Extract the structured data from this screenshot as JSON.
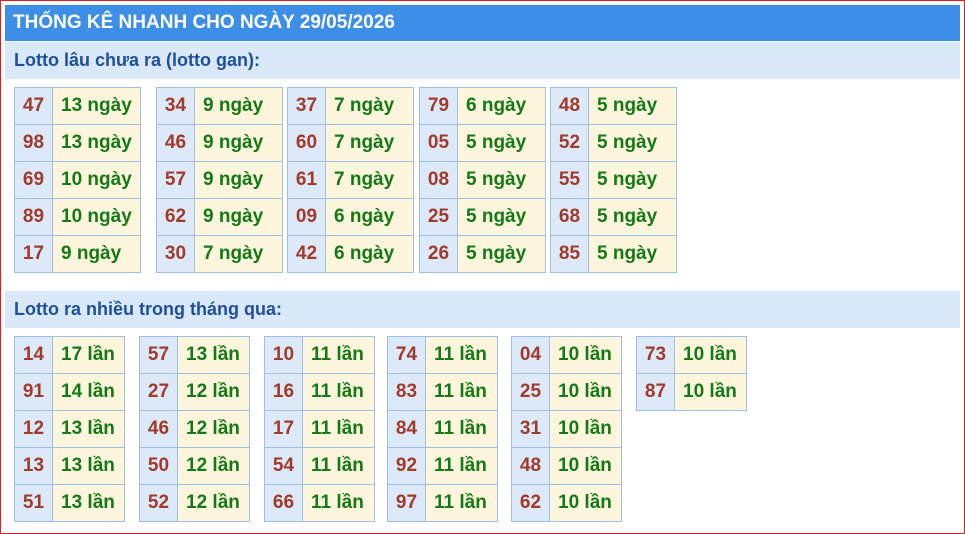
{
  "title": "THỐNG KÊ NHANH CHO NGÀY 29/05/2026",
  "sections": [
    {
      "header": "Lotto lâu chưa ra (lotto gan):",
      "groups": [
        [
          {
            "n": "47",
            "c": "13 ngày"
          },
          {
            "n": "98",
            "c": "13 ngày"
          },
          {
            "n": "69",
            "c": "10 ngày"
          },
          {
            "n": "89",
            "c": "10 ngày"
          },
          {
            "n": "17",
            "c": "9 ngày"
          }
        ],
        [
          {
            "n": "34",
            "c": "9 ngày"
          },
          {
            "n": "46",
            "c": "9 ngày"
          },
          {
            "n": "57",
            "c": "9 ngày"
          },
          {
            "n": "62",
            "c": "9 ngày"
          },
          {
            "n": "30",
            "c": "7 ngày"
          }
        ],
        [
          {
            "n": "37",
            "c": "7 ngày"
          },
          {
            "n": "60",
            "c": "7 ngày"
          },
          {
            "n": "61",
            "c": "7 ngày"
          },
          {
            "n": "09",
            "c": "6 ngày"
          },
          {
            "n": "42",
            "c": "6 ngày"
          }
        ],
        [
          {
            "n": "79",
            "c": "6 ngày"
          },
          {
            "n": "05",
            "c": "5 ngày"
          },
          {
            "n": "08",
            "c": "5 ngày"
          },
          {
            "n": "25",
            "c": "5 ngày"
          },
          {
            "n": "26",
            "c": "5 ngày"
          }
        ],
        [
          {
            "n": "48",
            "c": "5 ngày"
          },
          {
            "n": "52",
            "c": "5 ngày"
          },
          {
            "n": "55",
            "c": "5 ngày"
          },
          {
            "n": "68",
            "c": "5 ngày"
          },
          {
            "n": "85",
            "c": "5 ngày"
          }
        ]
      ]
    },
    {
      "header": "Lotto ra nhiều trong tháng qua:",
      "groups": [
        [
          {
            "n": "14",
            "c": "17 lần"
          },
          {
            "n": "91",
            "c": "14 lần"
          },
          {
            "n": "12",
            "c": "13 lần"
          },
          {
            "n": "13",
            "c": "13 lần"
          },
          {
            "n": "51",
            "c": "13 lần"
          }
        ],
        [
          {
            "n": "57",
            "c": "13 lần"
          },
          {
            "n": "27",
            "c": "12 lần"
          },
          {
            "n": "46",
            "c": "12 lần"
          },
          {
            "n": "50",
            "c": "12 lần"
          },
          {
            "n": "52",
            "c": "12 lần"
          }
        ],
        [
          {
            "n": "10",
            "c": "11 lần"
          },
          {
            "n": "16",
            "c": "11 lần"
          },
          {
            "n": "17",
            "c": "11 lần"
          },
          {
            "n": "54",
            "c": "11 lần"
          },
          {
            "n": "66",
            "c": "11 lần"
          }
        ],
        [
          {
            "n": "74",
            "c": "11 lần"
          },
          {
            "n": "83",
            "c": "11 lần"
          },
          {
            "n": "84",
            "c": "11 lần"
          },
          {
            "n": "92",
            "c": "11 lần"
          },
          {
            "n": "97",
            "c": "11 lần"
          }
        ],
        [
          {
            "n": "04",
            "c": "10 lần"
          },
          {
            "n": "25",
            "c": "10 lần"
          },
          {
            "n": "31",
            "c": "10 lần"
          },
          {
            "n": "48",
            "c": "10 lần"
          },
          {
            "n": "62",
            "c": "10 lần"
          }
        ],
        [
          {
            "n": "73",
            "c": "10 lần"
          },
          {
            "n": "87",
            "c": "10 lần"
          }
        ]
      ]
    }
  ]
}
